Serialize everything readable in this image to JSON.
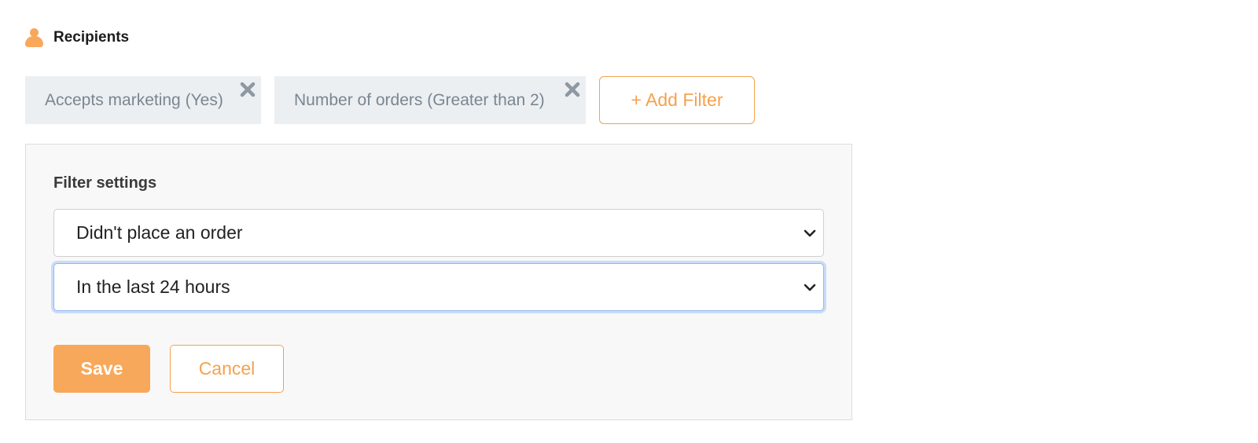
{
  "header": {
    "icon": "person-icon",
    "title": "Recipients"
  },
  "filters": [
    {
      "label": "Accepts marketing (Yes)",
      "close_icon": "close-icon"
    },
    {
      "label": "Number of orders (Greater than 2)",
      "close_icon": "close-icon"
    }
  ],
  "add_filter": {
    "label": "+ Add Filter"
  },
  "panel": {
    "title": "Filter settings",
    "select_1": {
      "value": "Didn't place an order",
      "icon": "chevron-down-icon"
    },
    "select_2": {
      "value": "In the last 24 hours",
      "icon": "chevron-down-icon"
    },
    "save_label": "Save",
    "cancel_label": "Cancel"
  },
  "colors": {
    "accent": "#f5a14f",
    "chip_bg": "#eceff2",
    "chip_text": "#7a8691",
    "focus_ring": "#8fb8ef"
  }
}
